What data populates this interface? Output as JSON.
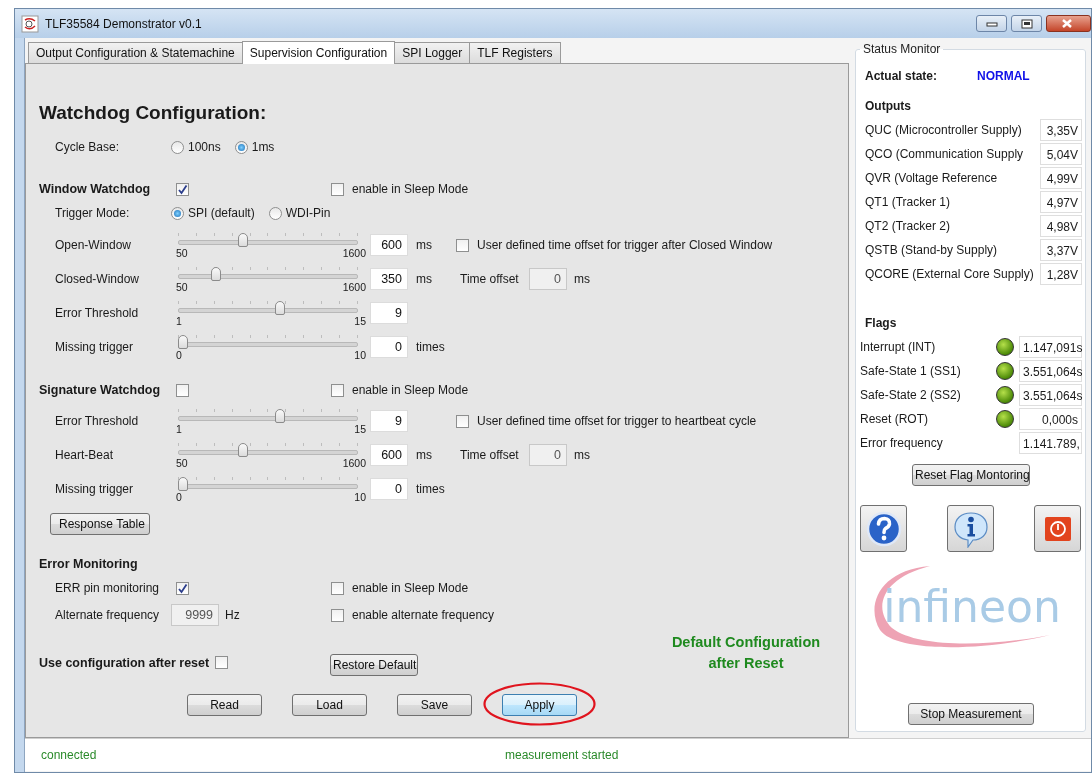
{
  "window": {
    "title": "TLF35584 Demonstrator v0.1"
  },
  "tabs": [
    {
      "label": "Output Configuration & Statemachine",
      "selected": false
    },
    {
      "label": "Supervision Configuration",
      "selected": true
    },
    {
      "label": "SPI Logger",
      "selected": false
    },
    {
      "label": "TLF Registers",
      "selected": false
    }
  ],
  "heading": "Watchdog Configuration:",
  "cycle_base": {
    "label": "Cycle Base:",
    "options": [
      {
        "label": "100ns",
        "selected": false
      },
      {
        "label": "1ms",
        "selected": true
      }
    ]
  },
  "window_watchdog": {
    "title": "Window Watchdog",
    "checked": true,
    "sleep": {
      "label": "enable in Sleep Mode",
      "checked": false
    },
    "trigger": {
      "label": "Trigger Mode:",
      "options": [
        {
          "label": "SPI (default)",
          "selected": true
        },
        {
          "label": "WDI-Pin",
          "selected": false
        }
      ]
    },
    "rows": [
      {
        "label": "Open-Window",
        "min": "50",
        "max": "1600",
        "level": 0.355,
        "value": "600",
        "unit": "ms",
        "option": {
          "label": "User defined time offset for trigger after Closed Window",
          "checked": false
        }
      },
      {
        "label": "Closed-Window",
        "min": "50",
        "max": "1600",
        "level": 0.194,
        "value": "350",
        "unit": "ms",
        "offset": {
          "label": "Time offset",
          "value": "0",
          "unit": "ms",
          "disabled": true
        }
      },
      {
        "label": "Error Threshold",
        "min": "1",
        "max": "15",
        "level": 0.571,
        "value": "9"
      },
      {
        "label": "Missing trigger",
        "min": "0",
        "max": "10",
        "level": 0,
        "value": "0",
        "unit": "times"
      }
    ]
  },
  "signature_watchdog": {
    "title": "Signature Watchdog",
    "checked": false,
    "sleep": {
      "label": "enable in Sleep Mode",
      "checked": false
    },
    "rows": [
      {
        "label": "Error Threshold",
        "min": "1",
        "max": "15",
        "level": 0.571,
        "value": "9",
        "option": {
          "label": "User defined time offset for trigger to heartbeat cycle",
          "checked": false
        }
      },
      {
        "label": "Heart-Beat",
        "min": "50",
        "max": "1600",
        "level": 0.355,
        "value": "600",
        "unit": "ms",
        "offset": {
          "label": "Time offset",
          "value": "0",
          "unit": "ms",
          "disabled": true
        }
      },
      {
        "label": "Missing trigger",
        "min": "0",
        "max": "10",
        "level": 0,
        "value": "0",
        "unit": "times"
      }
    ],
    "button": "Response Table"
  },
  "error_monitoring": {
    "title": "Error Monitoring",
    "err_pin": {
      "label": "ERR pin monitoring",
      "checked": true
    },
    "sleep": {
      "label": "enable in Sleep Mode",
      "checked": false
    },
    "alt_freq": {
      "label": "Alternate frequency",
      "value": "9999",
      "unit": "Hz",
      "disabled": true
    },
    "alt_enable": {
      "label": "enable alternate frequency",
      "checked": false
    }
  },
  "reset_config": {
    "label": "Use configuration after reset",
    "checked": false,
    "restore_button": "Restore Default",
    "note": "Default Configuration after Reset"
  },
  "buttons": [
    {
      "label": "Read",
      "highlighted": false
    },
    {
      "label": "Load",
      "highlighted": false
    },
    {
      "label": "Save",
      "highlighted": false
    },
    {
      "label": "Apply",
      "highlighted": true
    }
  ],
  "status_bar": [
    "connected",
    "measurement started"
  ],
  "status_monitor": {
    "title": "Status Monitor",
    "state_label": "Actual state:",
    "state": "NORMAL",
    "outputs_title": "Outputs",
    "outputs": [
      {
        "label": "QUC (Microcontroller Supply)",
        "value": "3,35V"
      },
      {
        "label": "QCO (Communication Supply",
        "value": "5,04V"
      },
      {
        "label": "QVR (Voltage Reference",
        "value": "4,99V"
      },
      {
        "label": "QT1 (Tracker 1)",
        "value": "4,97V"
      },
      {
        "label": "QT2 (Tracker 2)",
        "value": "4,98V"
      },
      {
        "label": "QSTB (Stand-by Supply)",
        "value": "3,37V"
      },
      {
        "label": "QCORE (External Core Supply)",
        "value": "1,28V"
      }
    ],
    "flags_title": "Flags",
    "flags": [
      {
        "kind": "led",
        "label": "Interrupt (INT)",
        "on": true,
        "value": "1.147,091s"
      },
      {
        "kind": "led",
        "label": "Safe-State 1 (SS1)",
        "on": true,
        "value": "3.551,064s"
      },
      {
        "kind": "led",
        "label": "Safe-State 2 (SS2)",
        "on": true,
        "value": "3.551,064s"
      },
      {
        "kind": "led",
        "label": "Reset (ROT)",
        "on": true,
        "value": "0,000s"
      },
      {
        "kind": "plain",
        "label": "Error frequency",
        "value": "1.141.789,"
      }
    ],
    "reset_button": "Reset Flag Montoring",
    "logo": "infineon",
    "stop_button": "Stop Measurement"
  }
}
